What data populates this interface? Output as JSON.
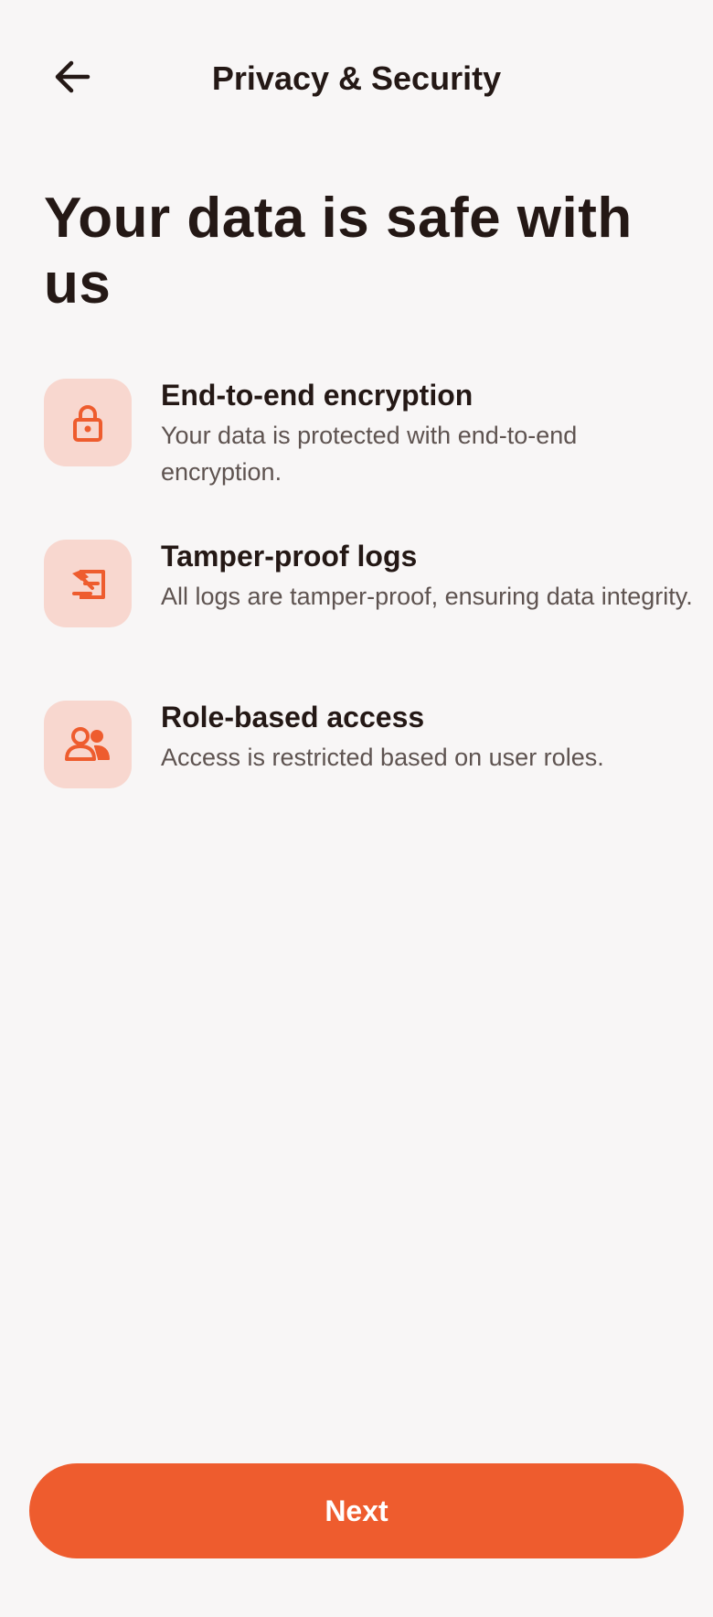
{
  "header": {
    "title": "Privacy & Security",
    "back_icon": "arrow-left-icon"
  },
  "hero": {
    "title": "Your data is safe with us"
  },
  "features": [
    {
      "icon": "lock-icon",
      "title": "End-to-end encryption",
      "description": "Your data is protected with end-to-end encryption."
    },
    {
      "icon": "tamper-proof-log-icon",
      "title": "Tamper-proof logs",
      "description": "All logs are tamper-proof, ensuring data integrity."
    },
    {
      "icon": "people-icon",
      "title": "Role-based access",
      "description": "Access is restricted based on user roles."
    }
  ],
  "footer": {
    "next_label": "Next"
  },
  "colors": {
    "accent": "#ee5c2e",
    "icon_background": "#f8d7cf",
    "page_background": "#f8f6f6",
    "text_primary": "#241815",
    "text_secondary": "#5e5350"
  }
}
